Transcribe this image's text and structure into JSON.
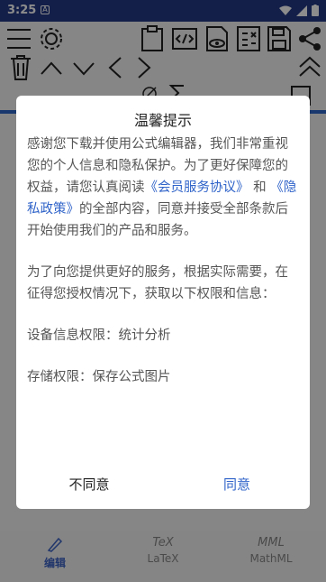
{
  "status": {
    "time": "3:25",
    "notif_icon": "A"
  },
  "nav": {
    "edit_label": "编辑",
    "latex_label": "LaTeX",
    "mathml_label": "MathML",
    "latex_glyph": "TeX",
    "mathml_glyph": "MML"
  },
  "dialog": {
    "title": "温馨提示",
    "para1_a": "感谢您下载并使用公式编辑器，我们非常重视您的个人信息和隐私保护。为了更好保障您的权益，请您认真阅读",
    "link1": "《会员服务协议》",
    "para1_b": " 和 ",
    "link2": "《隐私政策》",
    "para1_c": "的全部内容，同意并接受全部条款后开始使用我们的产品和服务。",
    "para2": "为了向您提供更好的服务，根据实际需要，在征得您授权情况下，获取以下权限和信息：",
    "para3": "设备信息权限：统计分析",
    "para4": "存储权限：保存公式图片",
    "disagree": "不同意",
    "agree": "同意"
  }
}
